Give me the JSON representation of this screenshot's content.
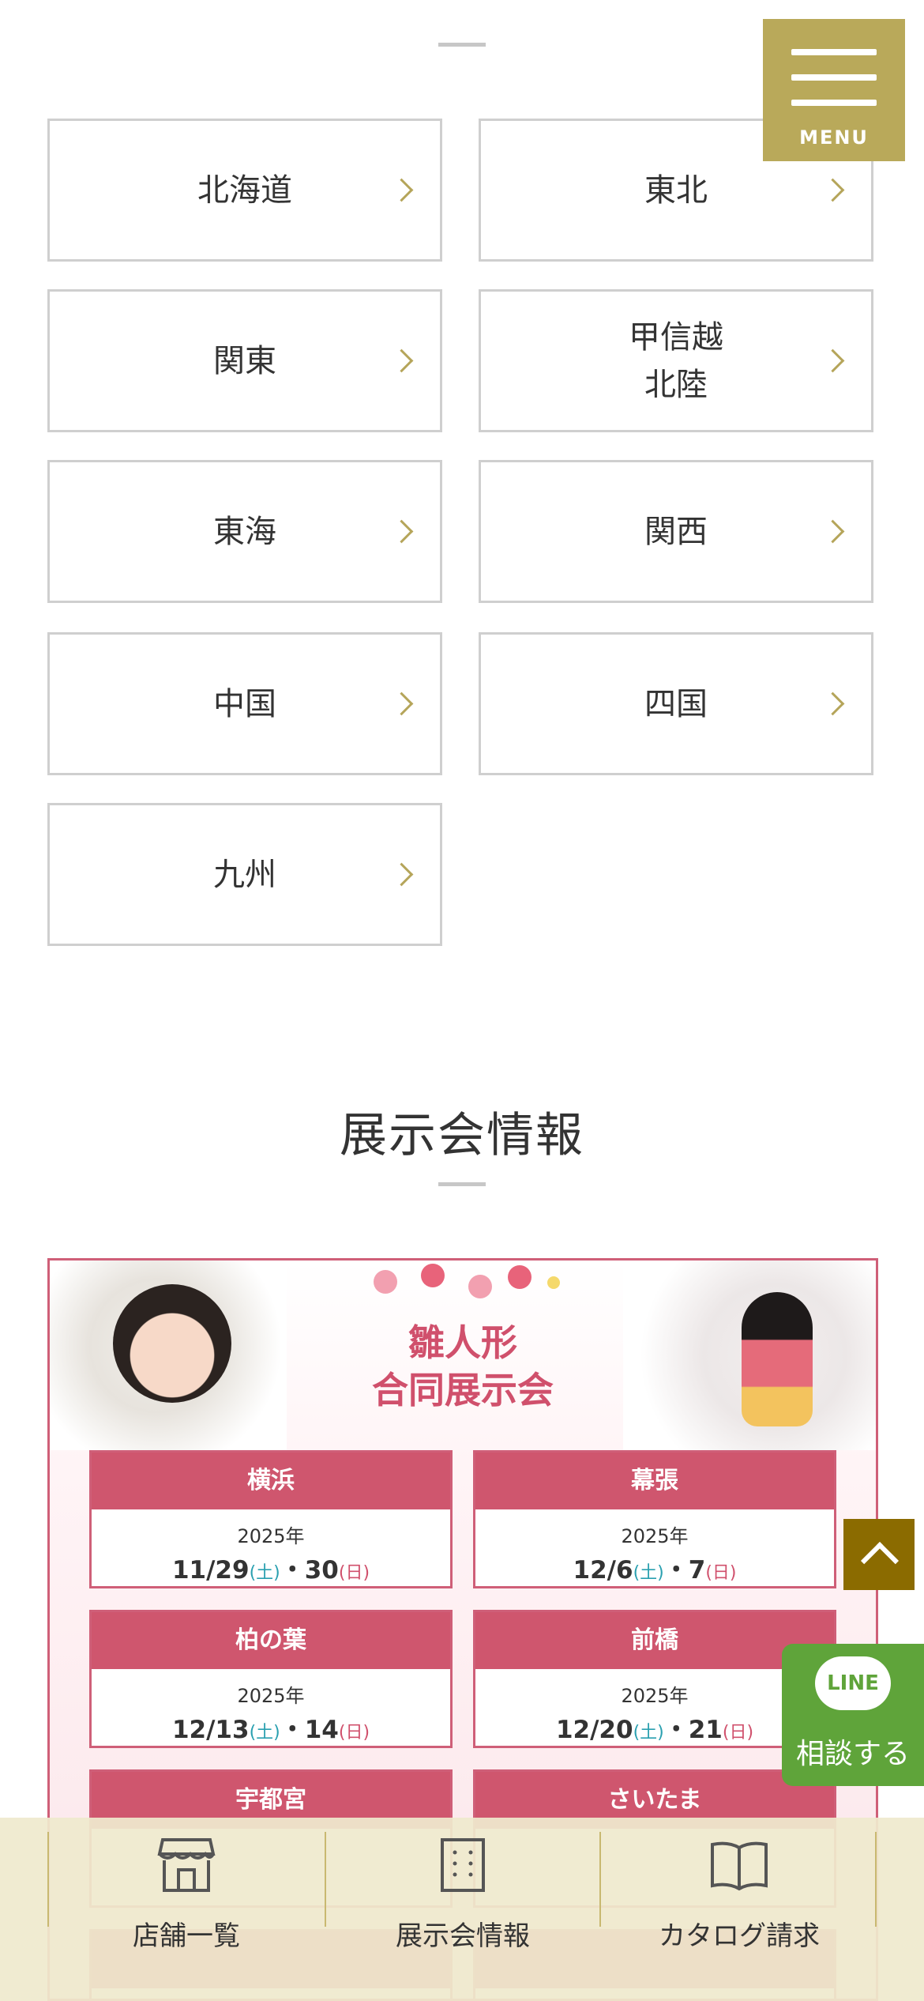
{
  "regions_section": {
    "regions": [
      {
        "label": "北海道"
      },
      {
        "label": "東北"
      },
      {
        "label": "関東"
      },
      {
        "label": "甲信越\n北陸"
      },
      {
        "label": "東海"
      },
      {
        "label": "関西"
      },
      {
        "label": "中国"
      },
      {
        "label": "四国"
      },
      {
        "label": "九州"
      }
    ]
  },
  "menu": {
    "label": "MENU"
  },
  "exhibition_section": {
    "title": "展示会情報",
    "banner_heading": "雛人形\n合同展示会",
    "venues": [
      {
        "name": "横浜",
        "year": "2025年",
        "date1": "11/29",
        "day1": "(土)",
        "sep": "・",
        "date2": "30",
        "day2": "(日)"
      },
      {
        "name": "幕張",
        "year": "2025年",
        "date1": "12/6",
        "day1": "(土)",
        "sep": "・",
        "date2": "7",
        "day2": "(日)"
      },
      {
        "name": "柏の葉",
        "year": "2025年",
        "date1": "12/13",
        "day1": "(土)",
        "sep": "・",
        "date2": "14",
        "day2": "(日)"
      },
      {
        "name": "前橋",
        "year": "2025年",
        "date1": "12/20",
        "day1": "(土)",
        "sep": "・",
        "date2": "21",
        "day2": "(日)"
      },
      {
        "name": "宇都宮"
      },
      {
        "name": "さいたま"
      }
    ]
  },
  "line_button": {
    "logo": "LINE",
    "label": "相談する"
  },
  "bottom_nav": {
    "items": [
      {
        "label": "店舗一覧",
        "icon": "storefront-icon"
      },
      {
        "label": "展示会情報",
        "icon": "building-icon"
      },
      {
        "label": "カタログ請求",
        "icon": "book-icon"
      }
    ]
  },
  "colors": {
    "accent": "#b9a95a",
    "pink": "#cf566e",
    "line_green": "#5fa43a",
    "scroll_brown": "#8b6b00"
  }
}
